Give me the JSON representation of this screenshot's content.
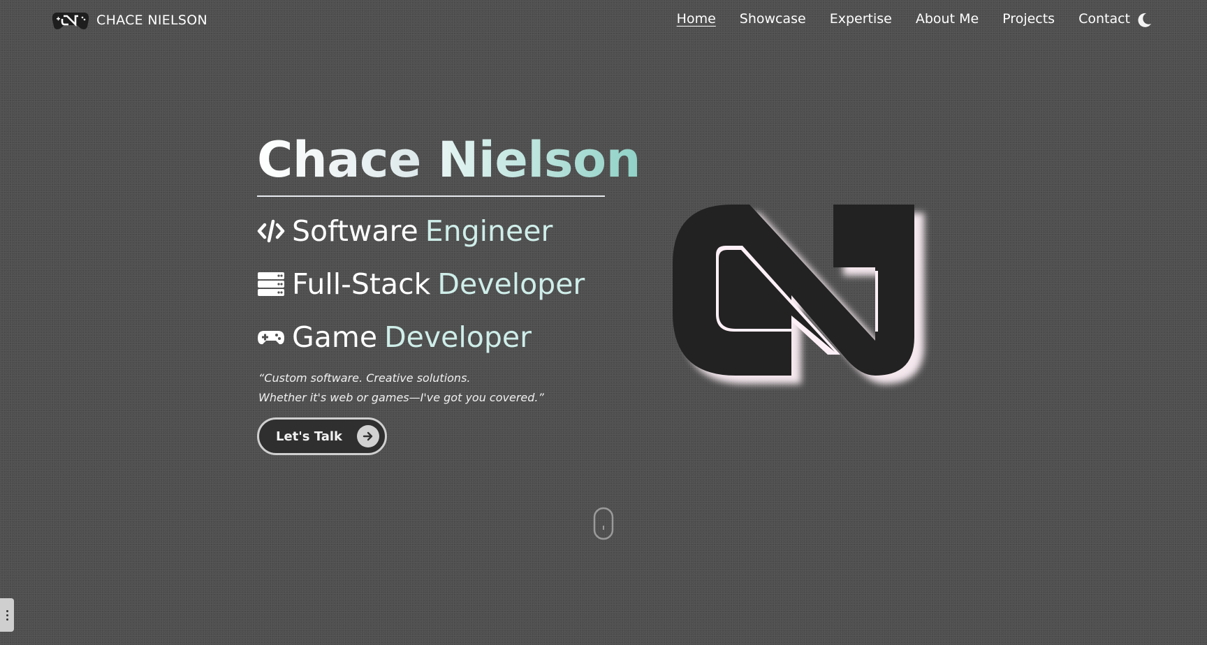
{
  "nav": {
    "brand_name": "CHACE NIELSON",
    "brand_icon": "gamepad-cn-logo-icon",
    "links": [
      {
        "label": "Home",
        "active": true
      },
      {
        "label": "Showcase",
        "active": false
      },
      {
        "label": "Expertise",
        "active": false
      },
      {
        "label": "About Me",
        "active": false
      },
      {
        "label": "Projects",
        "active": false
      },
      {
        "label": "Contact",
        "active": false
      }
    ],
    "theme_icon": "moon-icon"
  },
  "hero": {
    "first_name": "Chace",
    "last_name": "Nielson",
    "roles": [
      {
        "icon": "code-icon",
        "word1": "Software",
        "word2": "Engineer"
      },
      {
        "icon": "server-icon",
        "word1": "Full-Stack",
        "word2": "Developer"
      },
      {
        "icon": "gamepad-icon",
        "word1": "Game",
        "word2": "Developer"
      }
    ],
    "quote_line1": "“Custom software. Creative solutions.",
    "quote_line2": "Whether it's web or games—I've got you covered.”",
    "cta_label": "Let's Talk",
    "cta_icon": "arrow-right-icon",
    "logo_icon": "cn-monogram-logo",
    "scroll_icon": "mouse-scroll-icon"
  },
  "colors": {
    "background": "#4f4f4f",
    "accent_teal": "#8fd1c6",
    "logo_dark": "#222222"
  }
}
